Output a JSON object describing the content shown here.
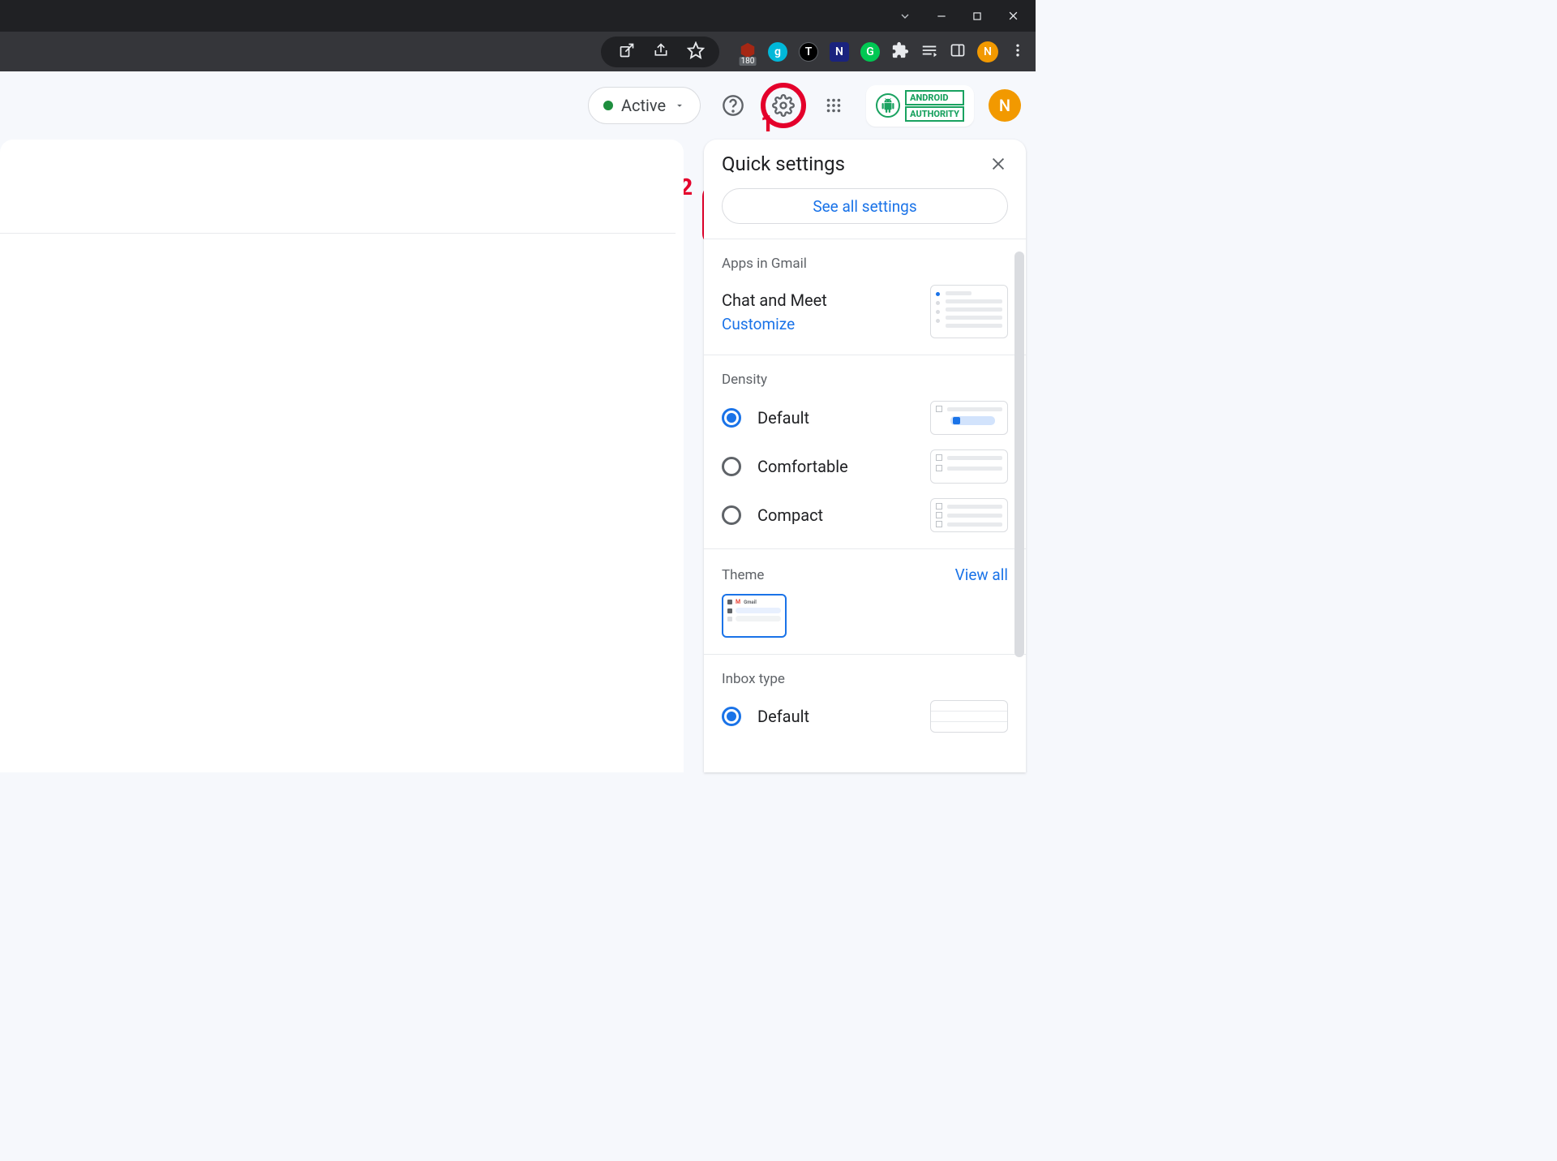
{
  "browser": {
    "ext_badge": "180",
    "avatar_letter": "N"
  },
  "header": {
    "status": "Active",
    "brand_line1": "ANDROID",
    "brand_line2": "AUTHORITY",
    "avatar_letter": "N"
  },
  "annotations": {
    "n1": "1",
    "n2": "2"
  },
  "qs": {
    "title": "Quick settings",
    "see_all": "See all settings",
    "apps": {
      "section": "Apps in Gmail",
      "name": "Chat and Meet",
      "customize": "Customize"
    },
    "density": {
      "section": "Density",
      "options": [
        "Default",
        "Comfortable",
        "Compact"
      ],
      "selected": 0
    },
    "theme": {
      "section": "Theme",
      "view_all": "View all"
    },
    "inbox": {
      "section": "Inbox type",
      "default": "Default"
    }
  }
}
